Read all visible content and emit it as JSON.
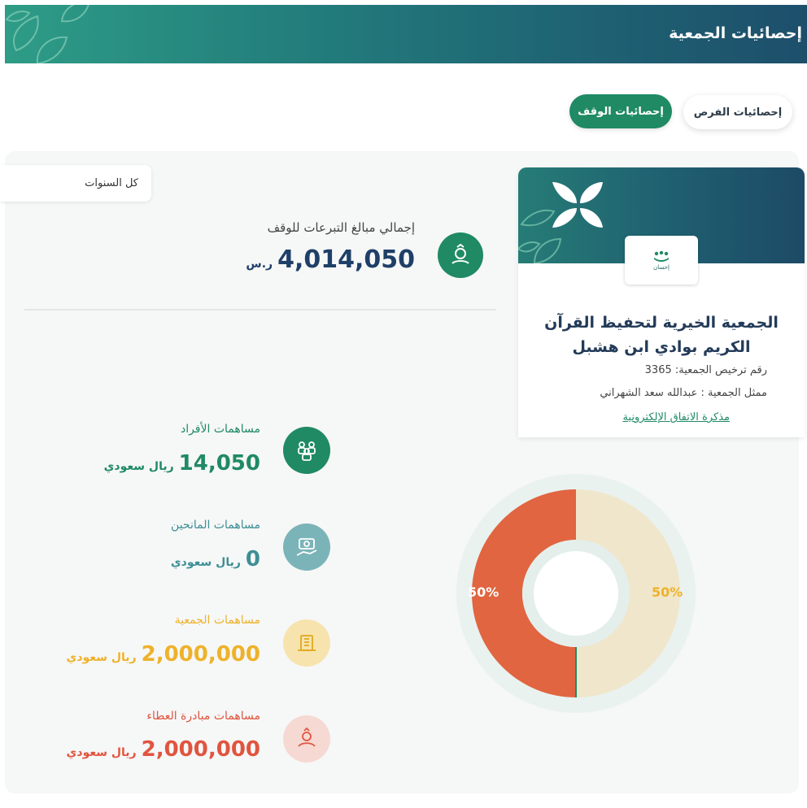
{
  "header": {
    "title": "إحصائيات الجمعية"
  },
  "tabs": [
    {
      "label": "إحصائيات الفرص",
      "active": false
    },
    {
      "label": "إحصائيات الوقف",
      "active": true
    }
  ],
  "filter": {
    "year_label": "كل السنوات"
  },
  "total": {
    "label": "إجمالي مبالغ التبرعات للوقف",
    "value": "4,014,050",
    "currency": "ر.س"
  },
  "association": {
    "logo_text": "إحسان",
    "name": "الجمعية الخيرية لتحفيظ القرآن الكريم بوادي ابن هشبل",
    "license": "رقم ترخيص الجمعية: 3365",
    "representative": "ممثل الجمعية : عبدالله سعد الشهراني",
    "agreement_link": "مذكرة الاتفاق الإلكترونية"
  },
  "contributions": [
    {
      "label": "مساهمات الأفراد",
      "value": "14,050",
      "currency": "ريال سعودي",
      "color": "#1f8a64",
      "icon": "people-icon"
    },
    {
      "label": "مساهمات المانحين",
      "value": "0",
      "currency": "ريال سعودي",
      "color": "#3d8f95",
      "icon": "donor-icon"
    },
    {
      "label": "مساهمات الجمعية",
      "value": "2,000,000",
      "currency": "ريال سعودي",
      "color": "#eeb22a",
      "icon": "building-icon"
    },
    {
      "label": "مساهمات مبادرة العطاء",
      "value": "2,000,000",
      "currency": "ريال سعودي",
      "color": "#e0553f",
      "icon": "giving-hand-icon"
    }
  ],
  "chart_data": {
    "type": "pie",
    "slices": [
      {
        "label": "50%",
        "value": 50,
        "color": "#f0e6cb",
        "label_color": "#eeb22a"
      },
      {
        "label": "50%",
        "value": 50,
        "color": "#e06540",
        "label_color": "#ffffff"
      }
    ]
  }
}
